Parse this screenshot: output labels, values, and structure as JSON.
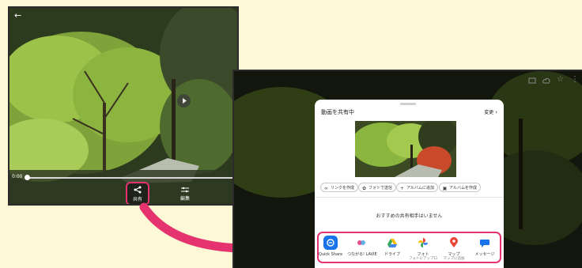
{
  "player": {
    "time": "0:00",
    "share_label": "共有",
    "edit_label": "編集"
  },
  "share_sheet": {
    "title": "動画を共有中",
    "change_label": "変更",
    "chips": [
      {
        "label": "リンクを作成",
        "icon": "link-icon"
      },
      {
        "label": "フォトで送信",
        "icon": "photos-icon"
      },
      {
        "label": "アルバムに追加",
        "icon": "plus-icon"
      },
      {
        "label": "アルバムを作成",
        "icon": "album-icon"
      }
    ],
    "no_contacts": "おすすめの共有相手はいません",
    "apps": [
      {
        "name": "Quick Share",
        "sub": "",
        "icon": "quick-share-icon",
        "color": "#1a73e8"
      },
      {
        "name": "つながる! LAVIE",
        "sub": "",
        "icon": "lavie-icon",
        "color": "#ea4c89"
      },
      {
        "name": "ドライブ",
        "sub": "",
        "icon": "drive-icon",
        "color": "#34a853"
      },
      {
        "name": "フォト",
        "sub": "フォトにアップロ",
        "icon": "photos-pinwheel-icon",
        "color": "#fbbc04"
      },
      {
        "name": "マップ",
        "sub": "マップに追加",
        "icon": "maps-icon",
        "color": "#ea4335"
      },
      {
        "name": "メッセージ",
        "sub": "",
        "icon": "messages-icon",
        "color": "#1a73e8"
      }
    ]
  },
  "colors": {
    "highlight": "#e5336f",
    "background": "#fdf8d6"
  }
}
